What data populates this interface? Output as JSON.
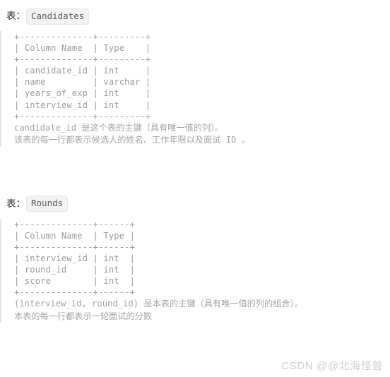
{
  "page": {
    "background_color": "#ffffff",
    "text_color": "#9b9b9b",
    "heading_color": "#2b2b2b",
    "accent_border_color": "#e3e3e3"
  },
  "tables": [
    {
      "heading_label": "表：",
      "name": "Candidates",
      "ascii": "+--------------+---------+\n| Column Name  | Type    |\n+--------------+---------+\n| candidate_id | int     |\n| name         | varchar |\n| years_of_exp | int     |\n| interview_id | int     |\n+--------------+---------+",
      "columns": [
        {
          "name": "candidate_id",
          "type": "int"
        },
        {
          "name": "name",
          "type": "varchar"
        },
        {
          "name": "years_of_exp",
          "type": "int"
        },
        {
          "name": "interview_id",
          "type": "int"
        }
      ],
      "column_headers": [
        "Column Name",
        "Type"
      ],
      "description": "candidate_id 是这个表的主键（具有唯一值的列）。\n该表的每一行都表示候选人的姓名、工作年限以及面试 ID 。"
    },
    {
      "heading_label": "表：",
      "name": "Rounds",
      "ascii": "+--------------+------+\n| Column Name  | Type |\n+--------------+------+\n| interview_id | int  |\n| round_id     | int  |\n| score        | int  |\n+--------------+------+",
      "columns": [
        {
          "name": "interview_id",
          "type": "int"
        },
        {
          "name": "round_id",
          "type": "int"
        },
        {
          "name": "score",
          "type": "int"
        }
      ],
      "column_headers": [
        "Column Name",
        "Type"
      ],
      "description": "(interview_id, round_id) 是本表的主键（具有唯一值的列的组合）。\n本表的每一行都表示一轮面试的分数"
    }
  ],
  "watermark": {
    "text": "CSDN @@北海怪兽"
  }
}
